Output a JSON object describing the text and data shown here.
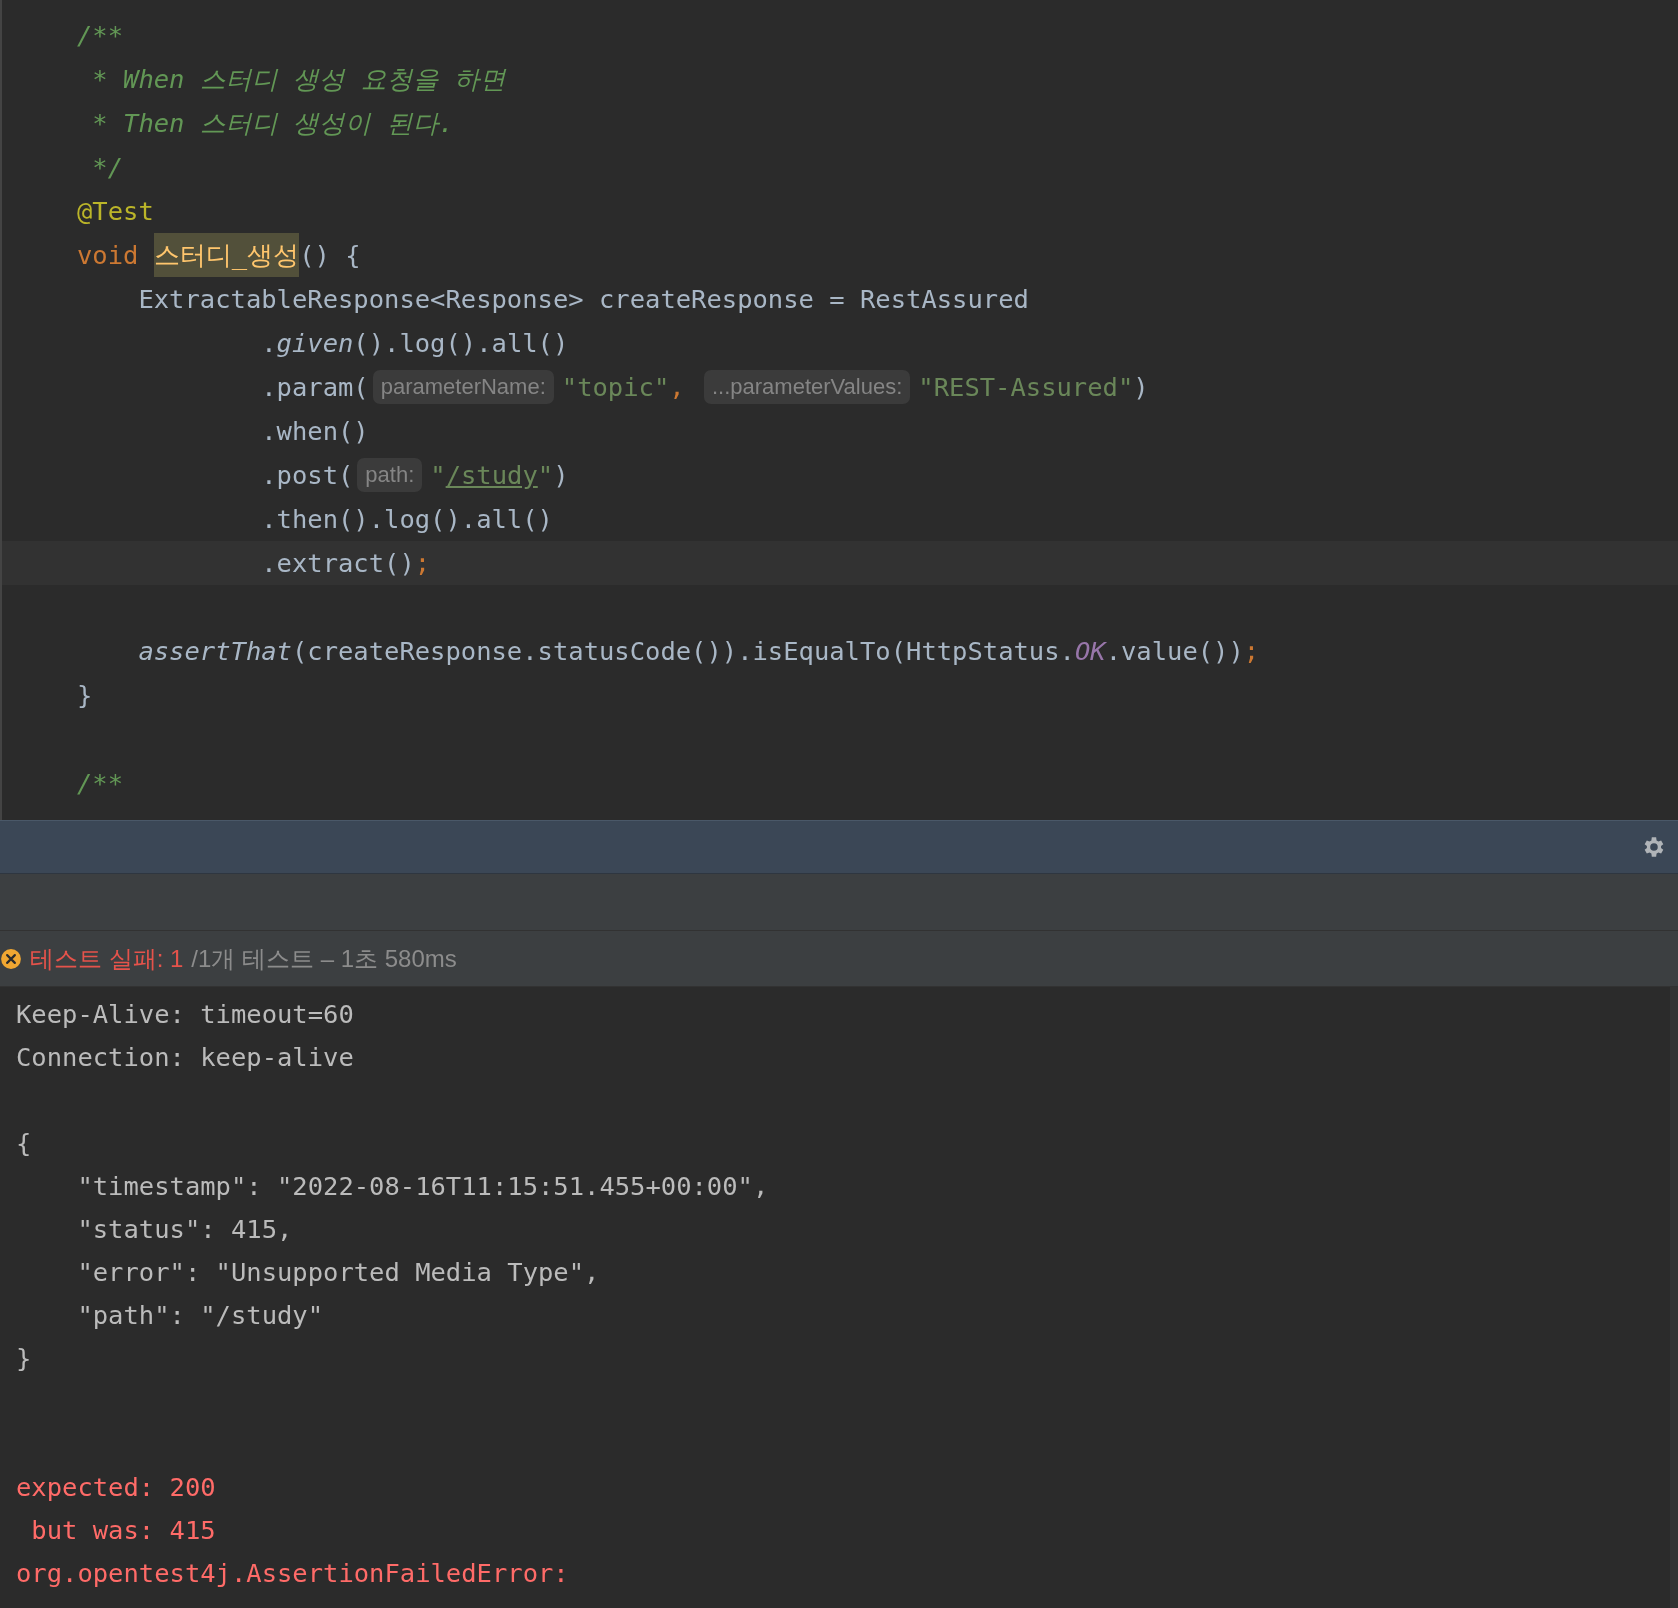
{
  "editor": {
    "lines": [
      {
        "kind": "code",
        "tokens": [
          {
            "kind": "comment",
            "text": "/**"
          }
        ]
      },
      {
        "kind": "code",
        "tokens": [
          {
            "kind": "comment",
            "text": " * When 스터디 생성 요청을 하면"
          }
        ]
      },
      {
        "kind": "code",
        "tokens": [
          {
            "kind": "comment",
            "text": " * Then 스터디 생성이 된다."
          }
        ]
      },
      {
        "kind": "code",
        "tokens": [
          {
            "kind": "comment",
            "text": " */"
          }
        ]
      },
      {
        "kind": "code",
        "tokens": [
          {
            "kind": "annotation",
            "text": "@Test"
          }
        ]
      },
      {
        "kind": "code",
        "tokens": [
          {
            "kind": "keyword",
            "text": "void "
          },
          {
            "kind": "highlight",
            "text": "스터디_생성"
          },
          {
            "kind": "plain",
            "text": "() {"
          }
        ]
      },
      {
        "kind": "code",
        "tokens": [
          {
            "kind": "plain",
            "text": "    ExtractableResponse<Response> createResponse = RestAssured"
          }
        ]
      },
      {
        "kind": "code",
        "tokens": [
          {
            "kind": "plain",
            "text": "            ."
          },
          {
            "kind": "italic",
            "text": "given"
          },
          {
            "kind": "plain",
            "text": "().log().all()"
          }
        ]
      },
      {
        "kind": "code",
        "tokens": [
          {
            "kind": "plain",
            "text": "            .param("
          },
          {
            "kind": "hint",
            "text": "parameterName:"
          },
          {
            "kind": "string",
            "text": "\"topic\""
          },
          {
            "kind": "keyword",
            "text": ", "
          },
          {
            "kind": "hint",
            "text": "...parameterValues:"
          },
          {
            "kind": "string",
            "text": "\"REST-Assured\""
          },
          {
            "kind": "plain",
            "text": ")"
          }
        ]
      },
      {
        "kind": "code",
        "tokens": [
          {
            "kind": "plain",
            "text": "            .when()"
          }
        ]
      },
      {
        "kind": "code",
        "tokens": [
          {
            "kind": "plain",
            "text": "            .post("
          },
          {
            "kind": "hint",
            "text": "path:"
          },
          {
            "kind": "string",
            "text": "\""
          },
          {
            "kind": "link",
            "text": "/study"
          },
          {
            "kind": "string",
            "text": "\""
          },
          {
            "kind": "plain",
            "text": ")"
          }
        ]
      },
      {
        "kind": "code",
        "tokens": [
          {
            "kind": "plain",
            "text": "            .then().log().all()"
          }
        ]
      },
      {
        "kind": "caret_line",
        "tokens": [
          {
            "kind": "plain",
            "text": "            .extract()"
          },
          {
            "kind": "keyword",
            "text": ";"
          }
        ]
      },
      {
        "kind": "blank"
      },
      {
        "kind": "code",
        "tokens": [
          {
            "kind": "italic",
            "text": "    assertThat"
          },
          {
            "kind": "plain",
            "text": "(createResponse.statusCode()).isEqualTo(HttpStatus."
          },
          {
            "kind": "constant",
            "text": "OK"
          },
          {
            "kind": "plain",
            "text": ".value())"
          },
          {
            "kind": "keyword",
            "text": ";"
          }
        ]
      },
      {
        "kind": "code",
        "tokens": [
          {
            "kind": "plain",
            "text": "}"
          }
        ]
      },
      {
        "kind": "blank"
      },
      {
        "kind": "code",
        "tokens": [
          {
            "kind": "comment",
            "text": "/**"
          }
        ]
      }
    ]
  },
  "status": {
    "failed_label": "테스트 실패: 1",
    "summary": "/1개 테스트 – 1초 580ms"
  },
  "console": [
    {
      "kind": "plain",
      "text": "Keep-Alive: timeout=60"
    },
    {
      "kind": "plain",
      "text": "Connection: keep-alive"
    },
    {
      "kind": "blank"
    },
    {
      "kind": "plain",
      "text": "{"
    },
    {
      "kind": "plain",
      "text": "    \"timestamp\": \"2022-08-16T11:15:51.455+00:00\","
    },
    {
      "kind": "plain",
      "text": "    \"status\": 415,"
    },
    {
      "kind": "plain",
      "text": "    \"error\": \"Unsupported Media Type\","
    },
    {
      "kind": "plain",
      "text": "    \"path\": \"/study\""
    },
    {
      "kind": "plain",
      "text": "}"
    },
    {
      "kind": "blank"
    },
    {
      "kind": "blank"
    },
    {
      "kind": "error",
      "text": "expected: 200"
    },
    {
      "kind": "error",
      "text": " but was: 415"
    },
    {
      "kind": "error",
      "text": "org.opentest4j.AssertionFailedError:"
    }
  ]
}
